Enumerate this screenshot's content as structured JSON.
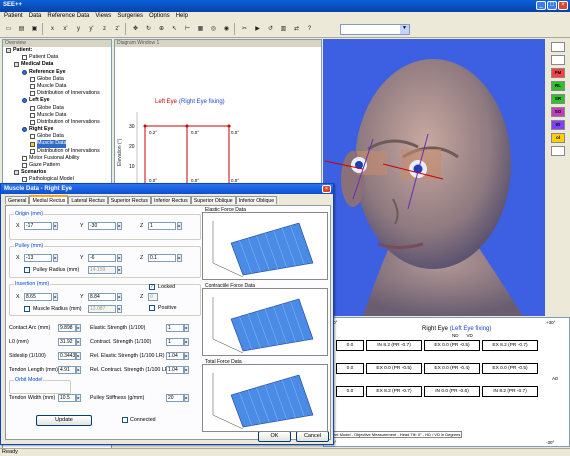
{
  "app": {
    "title": "SEE++",
    "status": "Ready"
  },
  "menu": [
    "Patient",
    "Data",
    "Reference Data",
    "Views",
    "Surgeries",
    "Options",
    "Help"
  ],
  "tree": {
    "header": "Overview",
    "items": [
      {
        "label": "Patient:",
        "indent": 0,
        "bold": true,
        "icon": "folder"
      },
      {
        "label": "Patient Data",
        "indent": 2,
        "bold": false,
        "icon": "doc"
      },
      {
        "label": "Medical Data",
        "indent": 1,
        "bold": true,
        "icon": "folder"
      },
      {
        "label": "Reference Eye",
        "indent": 2,
        "bold": true,
        "icon": "eye"
      },
      {
        "label": "Globe Data",
        "indent": 3,
        "bold": false,
        "icon": "doc"
      },
      {
        "label": "Muscle Data",
        "indent": 3,
        "bold": false,
        "icon": "doc"
      },
      {
        "label": "Distribution of Innervations",
        "indent": 3,
        "bold": false,
        "icon": "doc"
      },
      {
        "label": "Left Eye",
        "indent": 2,
        "bold": true,
        "icon": "eye"
      },
      {
        "label": "Globe Data",
        "indent": 3,
        "bold": false,
        "icon": "doc"
      },
      {
        "label": "Muscle Data",
        "indent": 3,
        "bold": false,
        "icon": "doc"
      },
      {
        "label": "Distribution of Innervations",
        "indent": 3,
        "bold": false,
        "icon": "doc"
      },
      {
        "label": "Right Eye",
        "indent": 2,
        "bold": true,
        "icon": "eye"
      },
      {
        "label": "Globe Data",
        "indent": 3,
        "bold": false,
        "icon": "doc"
      },
      {
        "label": "Muscle Data",
        "indent": 3,
        "bold": false,
        "icon": "sel"
      },
      {
        "label": "Distribution of Innervations",
        "indent": 3,
        "bold": false,
        "icon": "doc"
      },
      {
        "label": "Motor Fusional Ability",
        "indent": 2,
        "bold": false,
        "icon": "doc"
      },
      {
        "label": "Gaze Pattern",
        "indent": 2,
        "bold": false,
        "icon": "doc"
      },
      {
        "label": "Scenarios",
        "indent": 1,
        "bold": true,
        "icon": "folder"
      },
      {
        "label": "Pathological Model",
        "indent": 2,
        "bold": false,
        "icon": "doc"
      },
      {
        "label": "Initial Model",
        "indent": 3,
        "bold": false,
        "icon": "doc"
      }
    ]
  },
  "diagram": {
    "header": "Diagram Window 1",
    "title_left": "Left Eye",
    "title_right": "(Right Eye fixing)",
    "ylabel": "Elevation (°)",
    "yticks": [
      "30",
      "20",
      "10",
      "0"
    ],
    "cells_top": [
      "0.2°",
      "0.0°",
      "0.0°"
    ],
    "cells_mid": [
      "0.0°",
      "0.0°",
      "0.0°"
    ]
  },
  "dialog": {
    "title": "Muscle Data - Right Eye",
    "tabs": [
      "General",
      "Medial Rectus",
      "Lateral Rectus",
      "Superior Rectus",
      "Inferior Rectus",
      "Superior Oblique",
      "Inferior Oblique"
    ],
    "active_tab": 1,
    "origin": {
      "label": "Origin (mm)",
      "x": "-17",
      "y": "-30",
      "z": "1"
    },
    "pulley": {
      "label": "Pulley (mm)",
      "x": "-13",
      "y": "-6",
      "z": "0.1",
      "radius_label": "Pulley Radius (mm)",
      "radius": "14.159"
    },
    "insertion": {
      "label": "Insertion (mm)",
      "x": "8.65",
      "y": "8.84",
      "z": "0",
      "locked_label": "Locked",
      "positive_label": "Positive",
      "radius_label": "Muscle Radius (mm)",
      "radius": "13.087"
    },
    "axis_labels": {
      "x": "X",
      "y": "Y",
      "z": "Z"
    },
    "left_fields": [
      {
        "label": "Contact Arc (mm)",
        "value": "9.898"
      },
      {
        "label": "L0 (mm)",
        "value": "31.92"
      },
      {
        "label": "Sideslip (1/100)",
        "value": "0.3443"
      },
      {
        "label": "Tendon Length (mm)",
        "value": "4.91"
      },
      {
        "label": "Tendon Width (mm)",
        "value": "10.5"
      }
    ],
    "right_fields": [
      {
        "label": "Elastic Strength (1/100)",
        "value": "1"
      },
      {
        "label": "Contract. Strength (1/100)",
        "value": "1"
      },
      {
        "label": "Rel. Elastic Strength (1/100 LR)",
        "value": "1.04"
      },
      {
        "label": "Rel. Contract. Strength (1/100 LR)",
        "value": "1.04"
      },
      {
        "label": "Pulley Stiffness (g/mm)",
        "value": "20"
      }
    ],
    "orbit_model_label": "Orbit Model",
    "connected_label": "Connected",
    "update_label": "Update",
    "ok_label": "OK",
    "cancel_label": "Cancel",
    "plots": [
      "Elastic Force Data",
      "Contractile Force Data",
      "Total Force Data"
    ]
  },
  "right_chart": {
    "title": "Right Eye",
    "subtitle": "(Left Eye fixing)",
    "top_left": "+30°",
    "top_right": "+30°",
    "col_labels": [
      "ND",
      "VD",
      "AD"
    ],
    "rows": [
      [
        "0.0",
        "IN 8.2 (PR -0.7)",
        "EX 0.0 (PR -0.5)",
        "EX 8.2 (PR -0.7)"
      ],
      [
        "0.0",
        "EX 0.0 (PR -0.5)",
        "EX 0.0 (PR -0.4)",
        "EX 0.0 (PR -0.5)"
      ],
      [
        "0.0",
        "EX 8.2 (PR -0.7)",
        "IN 0.0 (PR -0.6)",
        "IN 8.2 (PR -0.7)"
      ]
    ],
    "left_values": [
      "0.0",
      "0.0",
      "0.0"
    ],
    "side_label": "AD",
    "footer": "Patient Model - Objective Measurement - Head Tilt: 0° - HD / VD in Degrees",
    "bottom_labels": [
      "-30°",
      "-30°"
    ]
  },
  "right_toolbar": [
    "",
    "",
    "PM",
    "RL",
    "SR",
    "SO",
    "IO",
    "ol",
    ""
  ]
}
